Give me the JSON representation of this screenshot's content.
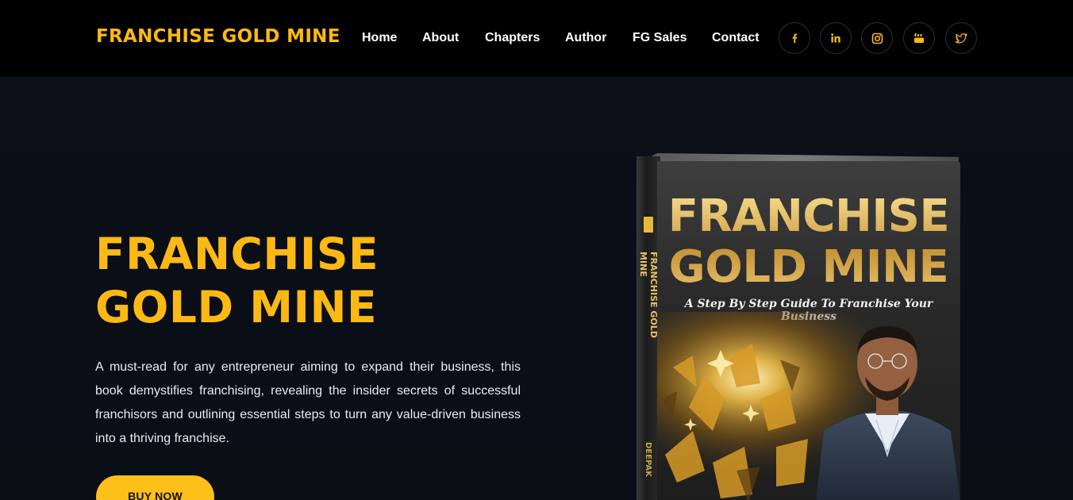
{
  "header": {
    "brand": "FRANCHISE GOLD MINE",
    "nav": [
      "Home",
      "About",
      "Chapters",
      "Author",
      "FG Sales",
      "Contact"
    ],
    "social_icons": [
      "facebook-icon",
      "linkedin-icon",
      "instagram-icon",
      "youtube-icon",
      "twitter-icon"
    ]
  },
  "hero": {
    "title_line1": "FRANCHISE",
    "title_line2": "GOLD MINE",
    "description": "A must-read for any entrepreneur aiming to expand their business, this book demystifies franchising, revealing the insider secrets of successful franchisors and outlining essential steps to turn any value-driven business into a thriving franchise.",
    "buy_button": "BUY NOW"
  },
  "book": {
    "title_line1": "FRANCHISE",
    "title_line2": "GOLD MINE",
    "subtitle": "A Step By Step Guide To Franchise Your Business",
    "spine_title": "FRANCHISE GOLD MINE",
    "spine_author": "DEEPAK"
  },
  "colors": {
    "accent": "#fdb913",
    "nav_bg": "#000000",
    "hero_bg": "#0a0f17",
    "button_bg": "#fdc01a"
  }
}
